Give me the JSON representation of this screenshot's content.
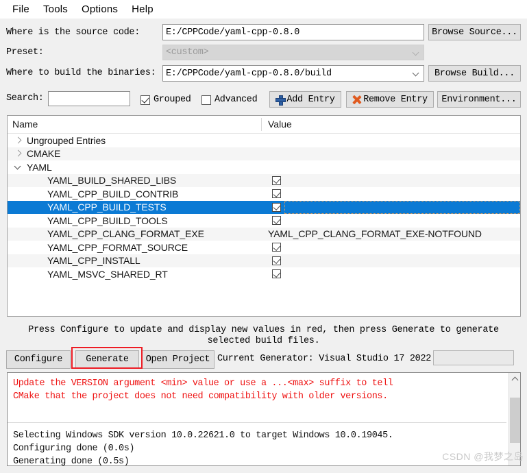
{
  "menu": {
    "items": [
      "File",
      "Tools",
      "Options",
      "Help"
    ]
  },
  "form": {
    "source_label": "Where is the source code:",
    "source_value": "E:/CPPCode/yaml-cpp-0.8.0",
    "browse_source_label": "Browse Source...",
    "preset_label": "Preset:",
    "preset_value": "<custom>",
    "build_label": "Where to build the binaries:",
    "build_value": "E:/CPPCode/yaml-cpp-0.8.0/build",
    "browse_build_label": "Browse Build..."
  },
  "toolbar": {
    "search_label": "Search:",
    "search_value": "",
    "search_placeholder": "",
    "grouped_label": "Grouped",
    "grouped_checked": true,
    "advanced_label": "Advanced",
    "advanced_checked": false,
    "add_entry_label": "Add Entry",
    "remove_entry_label": "Remove Entry",
    "environment_label": "Environment..."
  },
  "table": {
    "headers": {
      "name": "Name",
      "value": "Value"
    },
    "rows": [
      {
        "name": "Ungrouped Entries",
        "kind": "group",
        "expanded": false,
        "value_type": "none",
        "value": "",
        "band": false,
        "selected": false
      },
      {
        "name": "CMAKE",
        "kind": "group",
        "expanded": false,
        "value_type": "none",
        "value": "",
        "band": true,
        "selected": false
      },
      {
        "name": "YAML",
        "kind": "group",
        "expanded": true,
        "value_type": "none",
        "value": "",
        "band": false,
        "selected": false
      },
      {
        "name": "YAML_BUILD_SHARED_LIBS",
        "kind": "entry",
        "value_type": "checkbox",
        "value": "checked",
        "band": true,
        "selected": false
      },
      {
        "name": "YAML_CPP_BUILD_CONTRIB",
        "kind": "entry",
        "value_type": "checkbox",
        "value": "checked",
        "band": false,
        "selected": false
      },
      {
        "name": "YAML_CPP_BUILD_TESTS",
        "kind": "entry",
        "value_type": "checkbox",
        "value": "checked",
        "band": false,
        "selected": true
      },
      {
        "name": "YAML_CPP_BUILD_TOOLS",
        "kind": "entry",
        "value_type": "checkbox",
        "value": "checked",
        "band": false,
        "selected": false
      },
      {
        "name": "YAML_CPP_CLANG_FORMAT_EXE",
        "kind": "entry",
        "value_type": "text",
        "value": "YAML_CPP_CLANG_FORMAT_EXE-NOTFOUND",
        "band": true,
        "selected": false
      },
      {
        "name": "YAML_CPP_FORMAT_SOURCE",
        "kind": "entry",
        "value_type": "checkbox",
        "value": "checked",
        "band": false,
        "selected": false
      },
      {
        "name": "YAML_CPP_INSTALL",
        "kind": "entry",
        "value_type": "checkbox",
        "value": "checked",
        "band": true,
        "selected": false
      },
      {
        "name": "YAML_MSVC_SHARED_RT",
        "kind": "entry",
        "value_type": "checkbox",
        "value": "checked",
        "band": false,
        "selected": false
      }
    ]
  },
  "hint": {
    "line1": "Press Configure to update and display new values in red, then press Generate to generate",
    "line2": "selected build files."
  },
  "actions": {
    "configure_label": "Configure",
    "generate_label": "Generate",
    "open_project_label": "Open Project",
    "current_generator_label": "Current Generator: Visual Studio 17 2022",
    "highlight_color": "#ed1c24"
  },
  "log": {
    "red_color": "#ee1111",
    "lines": [
      {
        "text": "Update the VERSION argument <min> value or use a ...<max> suffix to tell",
        "color": "red"
      },
      {
        "text": "CMake that the project does not need compatibility with older versions.",
        "color": "red"
      },
      {
        "text": "",
        "color": "red"
      },
      {
        "text": "",
        "color": "black"
      },
      {
        "text": "Selecting Windows SDK version 10.0.22621.0 to target Windows 10.0.19045.",
        "color": "black"
      },
      {
        "text": "Configuring done (0.0s)",
        "color": "black"
      },
      {
        "text": "Generating done (0.5s)",
        "color": "black"
      }
    ]
  },
  "watermark": {
    "text": "CSDN @我梦之岛"
  }
}
